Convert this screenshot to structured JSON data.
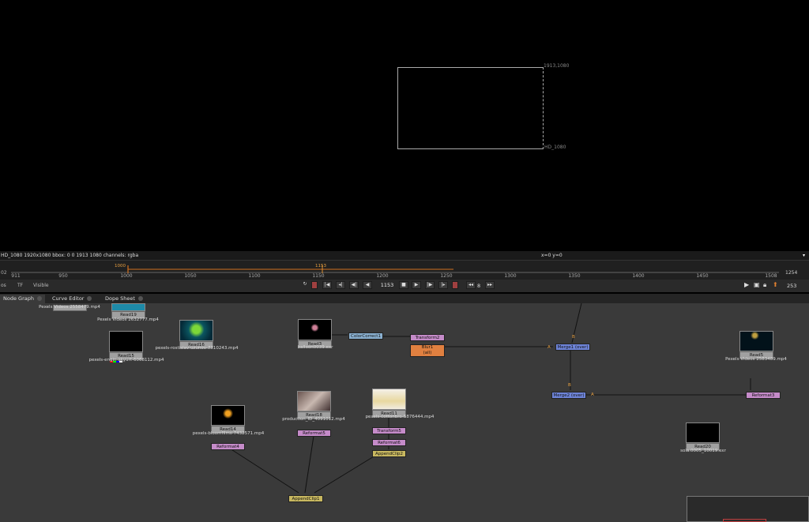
{
  "viewer": {
    "format_top_label": "1913,1080",
    "format_bottom_label": "HD_1080",
    "info_left": "HD_1080 1920x1080  bbox: 0 0 1913 1080 channels: rgba",
    "info_right": "x=0 y=0"
  },
  "timeline": {
    "start_label": "02",
    "in_frame": "1000",
    "current_frame_marker": "1153",
    "end_frame": "1254",
    "ticks": [
      "911",
      "950",
      "1000",
      "1050",
      "1100",
      "1150",
      "1200",
      "1250",
      "1300",
      "1350",
      "1400",
      "1450",
      "1508"
    ]
  },
  "controls": {
    "left_label": "os",
    "tf_label": "TF",
    "visible_label": "Visible",
    "current_frame": "1153",
    "increment": "8",
    "right_value": "253"
  },
  "tabs": [
    {
      "label": "Node Graph"
    },
    {
      "label": "Curve Editor"
    },
    {
      "label": "Dope Sheet"
    }
  ],
  "nodes": {
    "read19": {
      "name": "Read19",
      "file": "Pexels Videos 2632777.mp4"
    },
    "read_top": {
      "file": "Pexels Videos 2558479.mp4"
    },
    "read15": {
      "name": "Read15",
      "file": "pexels-engin-akyurt-6068112.mp4"
    },
    "read16": {
      "name": "Read16",
      "file": "pexels-rostislav-uzunov-7710243.mp4"
    },
    "read3": {
      "name": "Read3",
      "file": "balloon0039.exr"
    },
    "colorcorrect1": {
      "name": "ColorCorrect1"
    },
    "transform2": {
      "name": "Transform2"
    },
    "blur1": {
      "name": "Blur1",
      "sub": "(all)"
    },
    "merge1": {
      "name": "Merge1 (over)"
    },
    "merge2": {
      "name": "Merge2 (over)"
    },
    "read5": {
      "name": "Read5",
      "file": "Pexels Videos 2583489.mp4"
    },
    "reformat3": {
      "name": "Reformat3"
    },
    "read14": {
      "name": "Read14",
      "file": "pexels-bloomfilms-7432571.mp4"
    },
    "reformat4": {
      "name": "Reformat4"
    },
    "read18": {
      "name": "Read18",
      "file": "production_ID_4091012.mp4"
    },
    "reformat5": {
      "name": "Reformat5"
    },
    "read11": {
      "name": "Read11",
      "file": "pexels-cottonbro-5876444.mp4"
    },
    "transform5": {
      "name": "Transform5"
    },
    "reformat6": {
      "name": "Reformat6"
    },
    "appendclip2": {
      "name": "AppendClip2"
    },
    "appendclip1": {
      "name": "AppendClip1"
    },
    "read20": {
      "name": "Read20",
      "file": "sola.0005_10019.exr"
    }
  },
  "pipe_labels": {
    "a": "A",
    "b": "B"
  }
}
